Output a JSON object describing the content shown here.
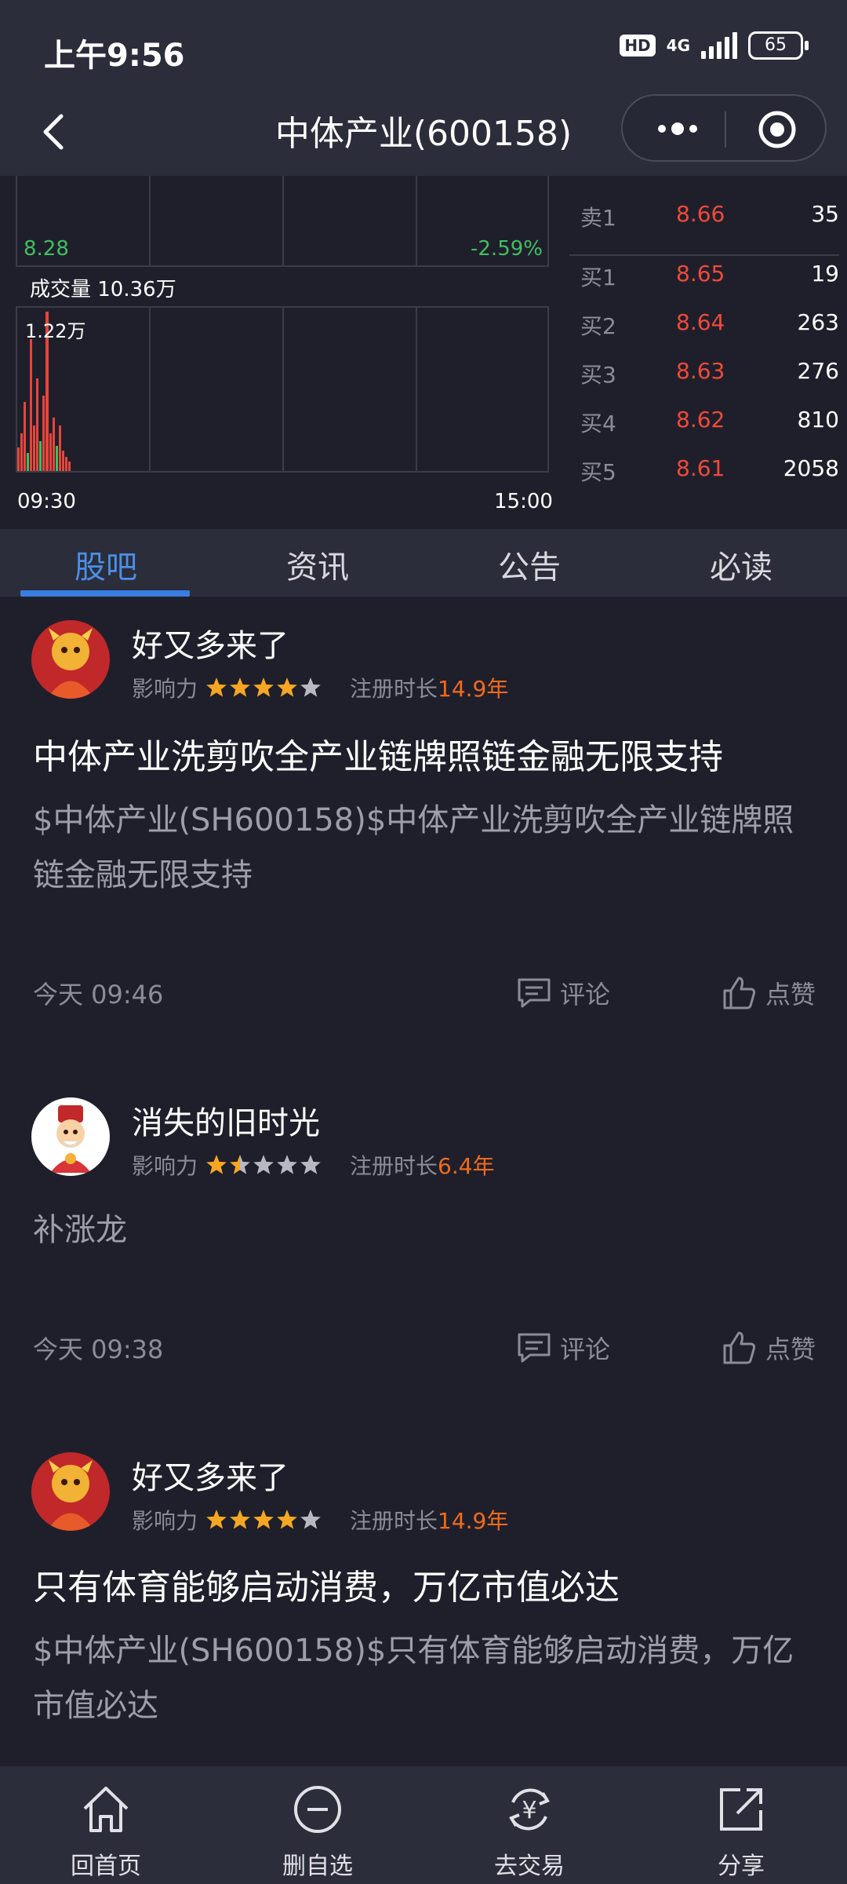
{
  "status_bar": {
    "time": "上午9:56",
    "hd": "HD",
    "network": "4G",
    "battery": "65"
  },
  "nav": {
    "title": "中体产业(600158)"
  },
  "chart": {
    "low_price": "8.28",
    "low_pct": "-2.59%",
    "volume_label": "成交量 10.36万",
    "volume_max": "1.22万",
    "time_start": "09:30",
    "time_end": "15:00"
  },
  "orderbook": {
    "sell": [
      {
        "label": "卖1",
        "price": "8.66",
        "qty": "35"
      }
    ],
    "buy": [
      {
        "label": "买1",
        "price": "8.65",
        "qty": "19"
      },
      {
        "label": "买2",
        "price": "8.64",
        "qty": "263"
      },
      {
        "label": "买3",
        "price": "8.63",
        "qty": "276"
      },
      {
        "label": "买4",
        "price": "8.62",
        "qty": "810"
      },
      {
        "label": "买5",
        "price": "8.61",
        "qty": "2058"
      }
    ]
  },
  "tabs": [
    {
      "label": "股吧",
      "active": true
    },
    {
      "label": "资讯"
    },
    {
      "label": "公告"
    },
    {
      "label": "必读"
    }
  ],
  "posts": [
    {
      "user": "好又多来了",
      "influence_label": "影响力",
      "stars": 4,
      "reg_label": "注册时长",
      "reg_years": "14.9年",
      "title": "中体产业洗剪吹全产业链牌照链金融无限支持",
      "body": "$中体产业(SH600158)$中体产业洗剪吹全产业链牌照链金融无限支持",
      "date": "今天 09:46",
      "comment_label": "评论",
      "like_label": "点赞"
    },
    {
      "user": "消失的旧时光",
      "influence_label": "影响力",
      "stars": 1.5,
      "reg_label": "注册时长",
      "reg_years": "6.4年",
      "title": "",
      "body": "补涨龙",
      "date": "今天 09:38",
      "comment_label": "评论",
      "like_label": "点赞"
    },
    {
      "user": "好又多来了",
      "influence_label": "影响力",
      "stars": 4,
      "reg_label": "注册时长",
      "reg_years": "14.9年",
      "title": "只有体育能够启动消费，万亿市值必达",
      "body": "$中体产业(SH600158)$只有体育能够启动消费，万亿市值必达"
    }
  ],
  "bottom_nav": [
    {
      "label": "回首页",
      "icon": "home-icon"
    },
    {
      "label": "删自选",
      "icon": "minus-circle-icon"
    },
    {
      "label": "去交易",
      "icon": "yuan-exchange-icon"
    },
    {
      "label": "分享",
      "icon": "share-icon"
    }
  ],
  "colors": {
    "background": "#1f1f2b",
    "bar": "#2b2d3a",
    "accent": "#3a7de0",
    "up": "#f04a3a",
    "down": "#3fbf5f",
    "star": "#f5a623",
    "years": "#f26b1d"
  }
}
